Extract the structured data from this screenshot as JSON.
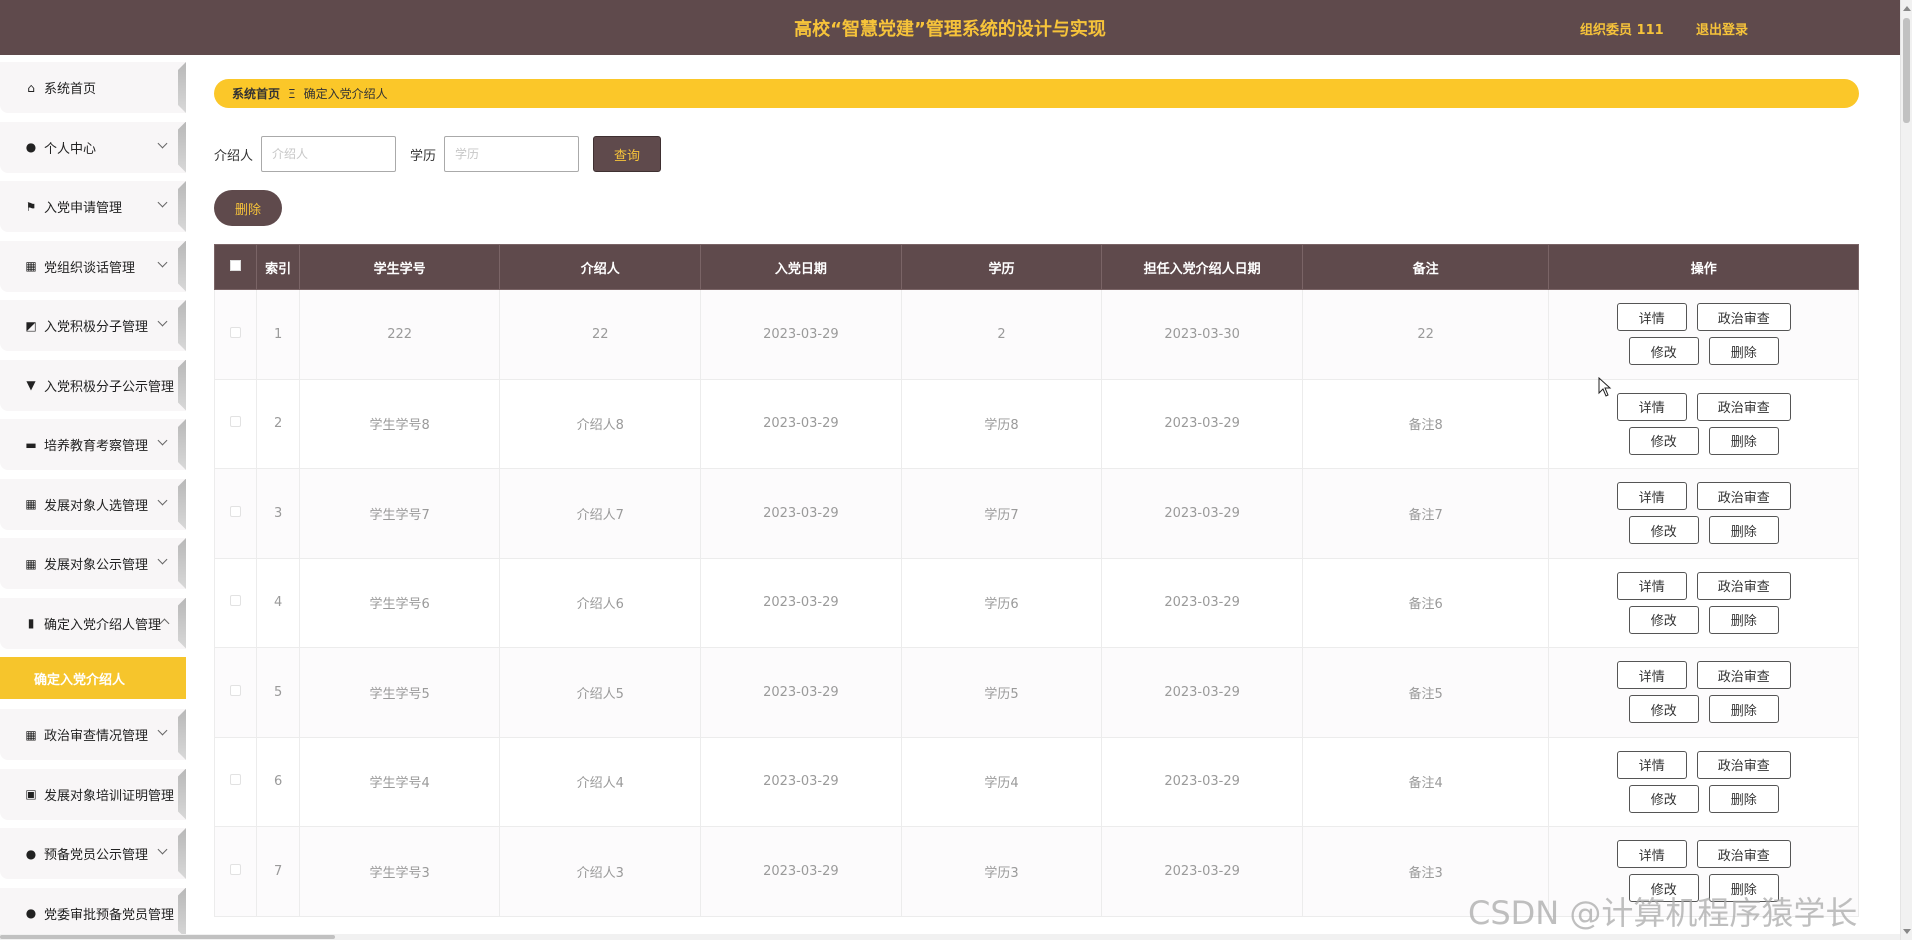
{
  "header": {
    "title": "高校“智慧党建”管理系统的设计与实现",
    "user": "组织委员 111",
    "logout": "退出登录"
  },
  "sidebar": {
    "items": [
      {
        "label": "系统首页",
        "icon": "home-icon",
        "glyph": "⌂",
        "arrow": false
      },
      {
        "label": "个人中心",
        "icon": "user-icon",
        "glyph": "●",
        "arrow": true
      },
      {
        "label": "入党申请管理",
        "icon": "flag-icon",
        "glyph": "⚑",
        "arrow": true
      },
      {
        "label": "党组织谈话管理",
        "icon": "grid-icon",
        "glyph": "▦",
        "arrow": true
      },
      {
        "label": "入党积极分子管理",
        "icon": "chart-line-icon",
        "glyph": "◩",
        "arrow": true
      },
      {
        "label": "入党积极分子公示管理",
        "icon": "pin-icon",
        "glyph": "▼",
        "arrow": false
      },
      {
        "label": "培养教育考察管理",
        "icon": "briefcase-icon",
        "glyph": "▬",
        "arrow": true
      },
      {
        "label": "发展对象人选管理",
        "icon": "grid-icon",
        "glyph": "▦",
        "arrow": true
      },
      {
        "label": "发展对象公示管理",
        "icon": "grid-icon",
        "glyph": "▦",
        "arrow": true
      },
      {
        "label": "确定入党介绍人管理",
        "icon": "bar-chart-icon",
        "glyph": "▮",
        "arrow": "up"
      }
    ],
    "active_sub": "确定入党介绍人",
    "items_after": [
      {
        "label": "政治审查情况管理",
        "icon": "grid-icon",
        "glyph": "▦",
        "arrow": true
      },
      {
        "label": "发展对象培训证明管理",
        "icon": "clipboard-icon",
        "glyph": "▣",
        "arrow": false
      },
      {
        "label": "预备党员公示管理",
        "icon": "user-icon",
        "glyph": "●",
        "arrow": true
      },
      {
        "label": "党委审批预备党员管理",
        "icon": "bulb-icon",
        "glyph": "●",
        "arrow": false
      }
    ]
  },
  "breadcrumb": {
    "home": "系统首页",
    "sep": "Ξ",
    "current": "确定入党介绍人"
  },
  "search": {
    "label1": "介绍人",
    "placeholder1": "介绍人",
    "label2": "学历",
    "placeholder2": "学历",
    "query": "查询"
  },
  "delete_button": "删除",
  "table": {
    "headers": [
      "索引",
      "学生学号",
      "介绍人",
      "入党日期",
      "学历",
      "担任入党介绍人日期",
      "备注",
      "操作"
    ],
    "rows": [
      {
        "index": "1",
        "student_no": "222",
        "introducer": "22",
        "join_date": "2023-03-29",
        "education": "2",
        "intro_date": "2023-03-30",
        "note": "22"
      },
      {
        "index": "2",
        "student_no": "学生学号8",
        "introducer": "介绍人8",
        "join_date": "2023-03-29",
        "education": "学历8",
        "intro_date": "2023-03-29",
        "note": "备注8"
      },
      {
        "index": "3",
        "student_no": "学生学号7",
        "introducer": "介绍人7",
        "join_date": "2023-03-29",
        "education": "学历7",
        "intro_date": "2023-03-29",
        "note": "备注7"
      },
      {
        "index": "4",
        "student_no": "学生学号6",
        "introducer": "介绍人6",
        "join_date": "2023-03-29",
        "education": "学历6",
        "intro_date": "2023-03-29",
        "note": "备注6"
      },
      {
        "index": "5",
        "student_no": "学生学号5",
        "introducer": "介绍人5",
        "join_date": "2023-03-29",
        "education": "学历5",
        "intro_date": "2023-03-29",
        "note": "备注5"
      },
      {
        "index": "6",
        "student_no": "学生学号4",
        "introducer": "介绍人4",
        "join_date": "2023-03-29",
        "education": "学历4",
        "intro_date": "2023-03-29",
        "note": "备注4"
      },
      {
        "index": "7",
        "student_no": "学生学号3",
        "introducer": "介绍人3",
        "join_date": "2023-03-29",
        "education": "学历3",
        "intro_date": "2023-03-29",
        "note": "备注3"
      }
    ],
    "actions": {
      "detail": "详情",
      "review": "政治审查",
      "edit": "修改",
      "delete": "删除"
    }
  },
  "watermark": "CSDN @计算机程序猿学长",
  "colors": {
    "header_bg": "#5f4a4c",
    "accent": "#f6c33a",
    "crumb_bg": "#fbc729"
  }
}
